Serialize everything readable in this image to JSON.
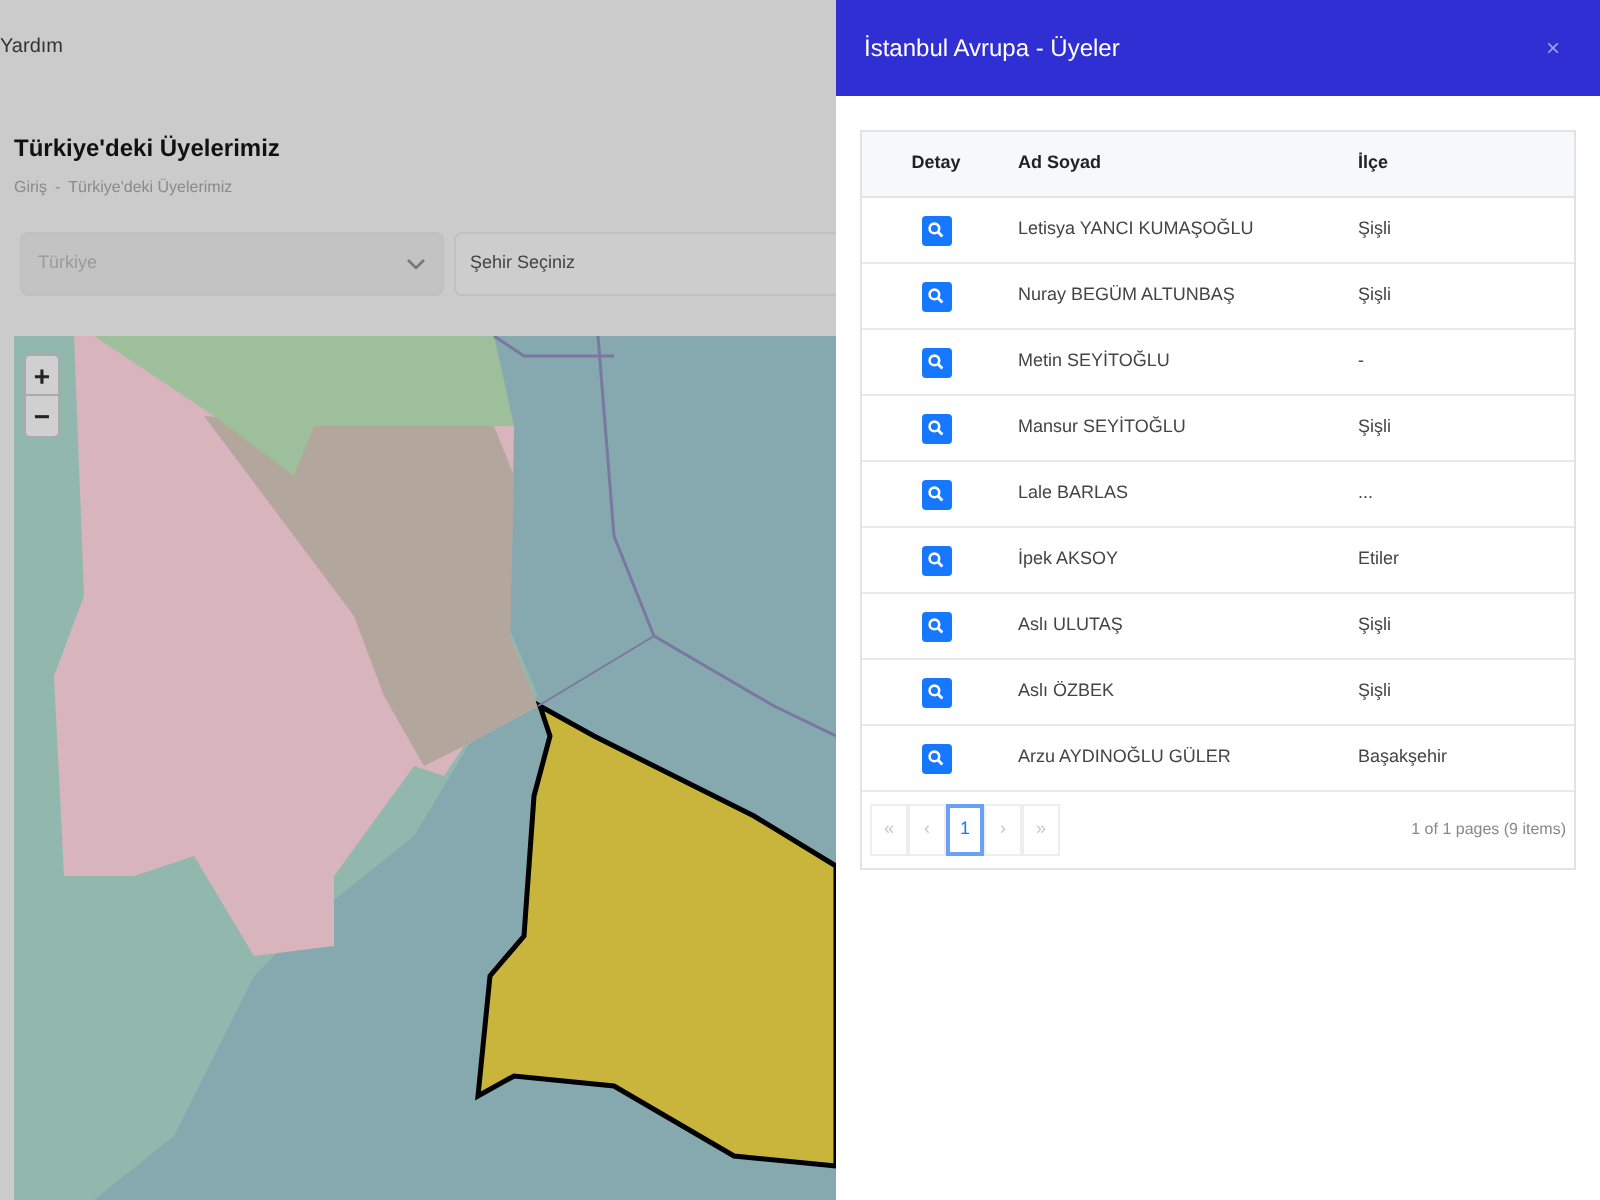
{
  "topbar": {
    "link": "Yardım"
  },
  "page": {
    "title": "Türkiye'deki Üyelerimiz",
    "breadcrumb": [
      {
        "label": "Giriş"
      },
      {
        "label": "Türkiye'deki Üyelerimiz"
      }
    ],
    "breadcrumb_separator": "-"
  },
  "filters": {
    "country": {
      "value": "Türkiye",
      "disabled": true
    },
    "city": {
      "placeholder": "Şehir Seçiniz"
    }
  },
  "map": {
    "zoom_in": "+",
    "zoom_out": "−"
  },
  "panel": {
    "title": "İstanbul Avrupa - Üyeler",
    "close": "×",
    "table": {
      "columns": [
        "Detay",
        "Ad Soyad",
        "İlçe"
      ],
      "rows": [
        {
          "name": "Letisya YANCI KUMAŞOĞLU",
          "district": "Şişli"
        },
        {
          "name": "Nuray BEGÜM ALTUNBAŞ",
          "district": "Şişli"
        },
        {
          "name": "Metin SEYİTOĞLU",
          "district": "-"
        },
        {
          "name": "Mansur SEYİTOĞLU",
          "district": "Şişli"
        },
        {
          "name": "Lale BARLAS",
          "district": "..."
        },
        {
          "name": "İpek AKSOY",
          "district": "Etiler"
        },
        {
          "name": "Aslı ULUTAŞ",
          "district": "Şişli"
        },
        {
          "name": "Aslı ÖZBEK",
          "district": "Şişli"
        },
        {
          "name": "Arzu AYDINOĞLU GÜLER",
          "district": "Başakşehir"
        }
      ]
    },
    "pagination": {
      "pages": [
        {
          "label": "«",
          "selected": false,
          "disabled": true
        },
        {
          "label": "‹",
          "selected": false,
          "disabled": true
        },
        {
          "label": "1",
          "selected": true,
          "disabled": false
        },
        {
          "label": "›",
          "selected": false,
          "disabled": true
        },
        {
          "label": "»",
          "selected": false,
          "disabled": true
        }
      ],
      "summary": "1 of 1 pages (9 items)"
    }
  }
}
